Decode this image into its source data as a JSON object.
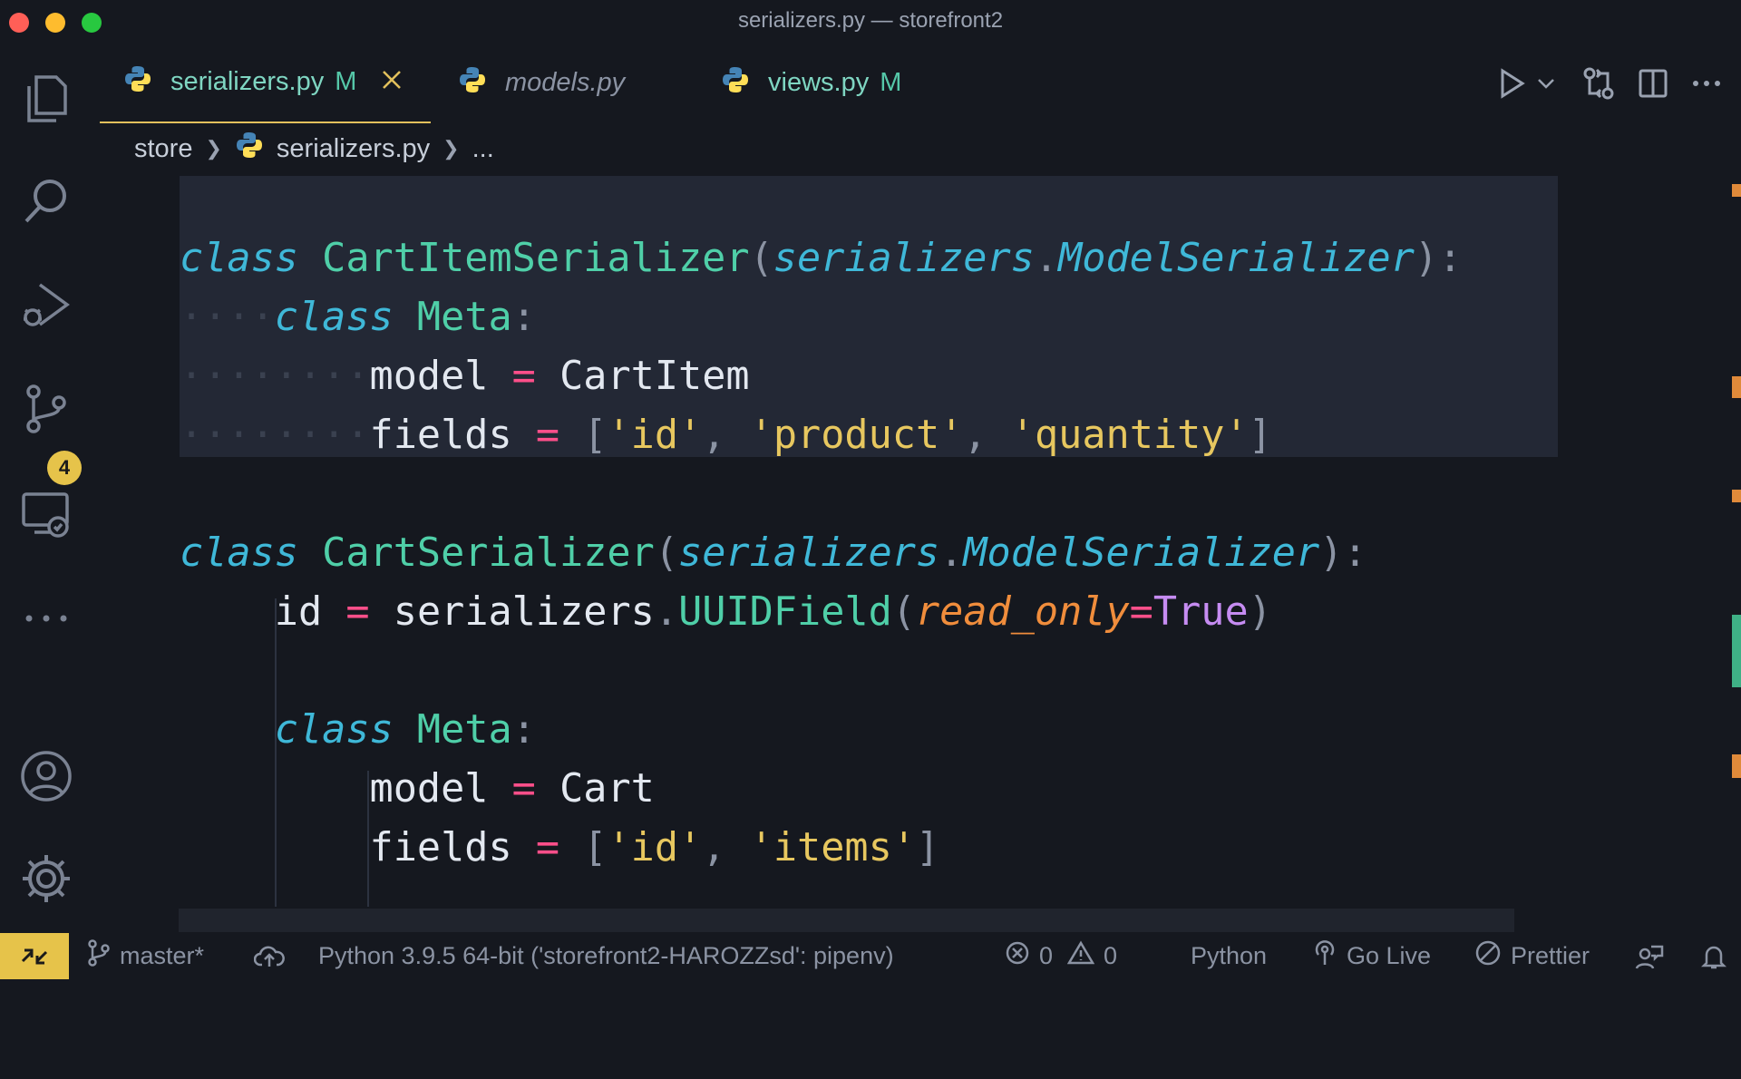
{
  "window": {
    "title": "serializers.py — storefront2"
  },
  "activity_bar": {
    "source_control_badge": "4"
  },
  "tabs": [
    {
      "label": "serializers.py",
      "status": "M",
      "active": true
    },
    {
      "label": "models.py",
      "status": "",
      "active": false
    },
    {
      "label": "views.py",
      "status": "M",
      "active": false
    }
  ],
  "breadcrumb": {
    "folder": "store",
    "file": "serializers.py",
    "more": "..."
  },
  "code": {
    "kw_class": "class",
    "l1": {
      "name": "CartItemSerializer",
      "open": "(",
      "module": "serializers",
      "dot": ".",
      "base": "ModelSerializer",
      "close": "):"
    },
    "l2": {
      "name": "Meta",
      "colon": ":"
    },
    "l3": {
      "var": "model",
      "eq": "=",
      "value": "CartItem"
    },
    "l4": {
      "var": "fields",
      "eq": "=",
      "open": "[",
      "s1": "'id'",
      "comma": ",",
      "s2": "'product'",
      "s3": "'quantity'",
      "close": "]"
    },
    "l5": {
      "name": "CartSerializer",
      "open": "(",
      "module": "serializers",
      "dot": ".",
      "base": "ModelSerializer",
      "close": "):"
    },
    "l6": {
      "var": "id",
      "eq": "=",
      "module": "serializers",
      "dot": ".",
      "fn": "UUIDField",
      "open": "(",
      "param": "read_only",
      "peq": "=",
      "bool": "True",
      "close": ")"
    },
    "l7": {
      "name": "Meta",
      "colon": ":"
    },
    "l8": {
      "var": "model",
      "eq": "=",
      "value": "Cart"
    },
    "l9": {
      "var": "fields",
      "eq": "=",
      "open": "[",
      "s1": "'id'",
      "comma": ",",
      "s2": "'items'",
      "close": "]"
    }
  },
  "status_bar": {
    "branch": "master*",
    "interpreter": "Python 3.9.5 64-bit ('storefront2-HAROZZsd': pipenv)",
    "errors": "0",
    "warnings": "0",
    "language": "Python",
    "go_live": "Go Live",
    "prettier": "Prettier"
  },
  "colors": {
    "accent": "#e6c34a",
    "modified": "#55c7a8",
    "added_gutter": "#3fb186",
    "changed_gutter": "#e08a3a"
  },
  "icons": [
    "explorer-icon",
    "search-icon",
    "run-debug-icon",
    "source-control-icon",
    "remote-explorer-icon",
    "more-icon",
    "account-icon",
    "settings-gear-icon",
    "python-icon",
    "close-icon",
    "run-icon",
    "chevron-down-icon",
    "compare-changes-icon",
    "split-editor-icon",
    "ellipsis-icon",
    "remote-icon",
    "git-branch-icon",
    "cloud-sync-icon",
    "error-icon",
    "warning-icon",
    "broadcast-icon",
    "prettier-icon",
    "feedback-icon",
    "bell-icon"
  ]
}
